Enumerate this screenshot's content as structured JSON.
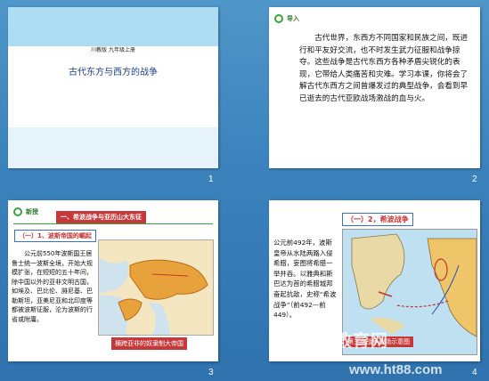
{
  "slides": [
    {
      "number": "1",
      "subtitle": "川教版 九年级上册",
      "title": "古代东方与西方的战争"
    },
    {
      "number": "2",
      "tag": "导入",
      "body": "古代世界，东西方不同国家和民族之间，既进行和平友好交流，也不时发生武力征服和战争掠夺。这些战争是古代东西方各种矛盾尖锐化的表现，它带给人类痛苦和灾难。学习本课，你将会了解古代东西方之间曾爆发过的典型战争，会看到早已逝去的古代亚欧战场激战的血与火。"
    },
    {
      "number": "3",
      "tag": "新授",
      "heading": "一、希波战争与亚历山大东征",
      "subheading": "（一）1、波斯帝国的崛起",
      "body": "公元前550年波斯国王居鲁士统一波斯全境，开始大规模扩张，在短短的五十年间，除中国以外的亚非文明古国，如埃及、巴比伦、腓尼基、巴勒斯坦，亚美尼亚和北印度等都被波斯征服，沦为波斯的行省或附庸。",
      "caption": "横跨亚非的奴隶制大帝国"
    },
    {
      "number": "4",
      "heading": "（一）2，希波战争",
      "body": "公元前492年，波斯皇帝从水陆两路入侵希腊，妄图将希腊一举并吞。以雅典和斯巴达为首的希腊城邦奋起抗敌，史称“希波战争”（前492—前449）。",
      "caption": "第三次战争战场示意图"
    }
  ],
  "watermark": {
    "site_cn": "育星教育网",
    "site_url": "www.ht88.com"
  }
}
